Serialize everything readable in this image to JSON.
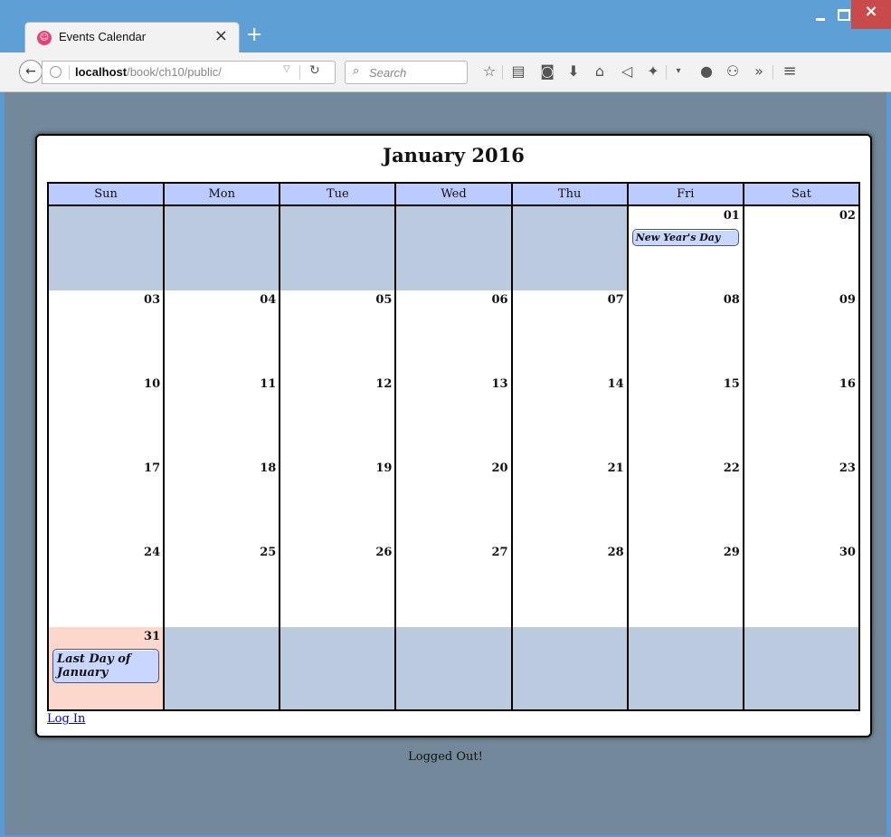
{
  "browser": {
    "tab_title": "Events Calendar",
    "tab_close": "×",
    "new_tab": "+",
    "url_host": "localhost",
    "url_path": "/book/ch10/public/",
    "search_placeholder": "Search"
  },
  "calendar": {
    "title": "January 2016",
    "weekdays": [
      "Sun",
      "Mon",
      "Tue",
      "Wed",
      "Thu",
      "Fri",
      "Sat"
    ],
    "weeks": [
      [
        {
          "day": ""
        },
        {
          "day": ""
        },
        {
          "day": ""
        },
        {
          "day": ""
        },
        {
          "day": ""
        },
        {
          "day": "01",
          "event": "New Year's Day"
        },
        {
          "day": "02"
        }
      ],
      [
        {
          "day": "03"
        },
        {
          "day": "04"
        },
        {
          "day": "05"
        },
        {
          "day": "06"
        },
        {
          "day": "07"
        },
        {
          "day": "08"
        },
        {
          "day": "09"
        }
      ],
      [
        {
          "day": "10"
        },
        {
          "day": "11"
        },
        {
          "day": "12"
        },
        {
          "day": "13"
        },
        {
          "day": "14"
        },
        {
          "day": "15"
        },
        {
          "day": "16"
        }
      ],
      [
        {
          "day": "17"
        },
        {
          "day": "18"
        },
        {
          "day": "19"
        },
        {
          "day": "20"
        },
        {
          "day": "21"
        },
        {
          "day": "22"
        },
        {
          "day": "23"
        }
      ],
      [
        {
          "day": "24"
        },
        {
          "day": "25"
        },
        {
          "day": "26"
        },
        {
          "day": "27"
        },
        {
          "day": "28"
        },
        {
          "day": "29"
        },
        {
          "day": "30"
        }
      ],
      [
        {
          "day": "31",
          "event": "Last Day of January",
          "today": true
        },
        {
          "day": ""
        },
        {
          "day": ""
        },
        {
          "day": ""
        },
        {
          "day": ""
        },
        {
          "day": ""
        },
        {
          "day": ""
        }
      ]
    ],
    "login_link": "Log In"
  },
  "status_text": "Logged Out!",
  "colors": {
    "weekday_header": "#bbcaff",
    "padding_cell": "#bbcade",
    "today_cell": "#fbd8cb",
    "event_bg": "#c9d6ff",
    "page_bg": "#73899b"
  }
}
